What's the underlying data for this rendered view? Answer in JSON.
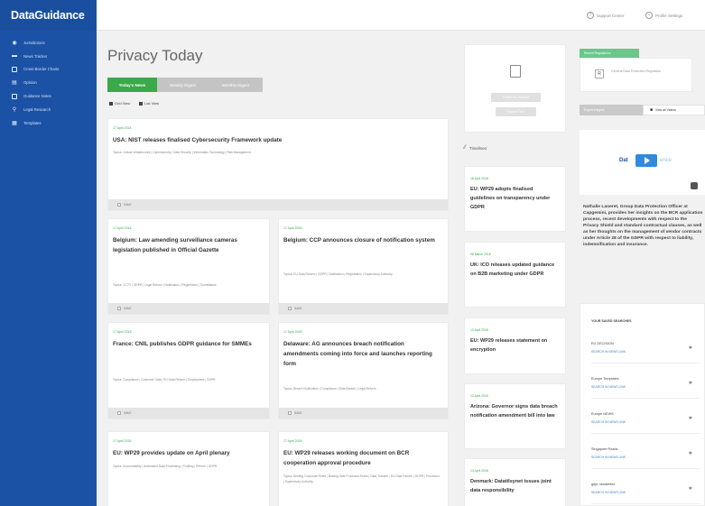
{
  "brand": "DataGuidance",
  "sidebar": {
    "items": [
      {
        "label": "Jurisdictions",
        "icon": "globe-icon"
      },
      {
        "label": "News Tracker",
        "icon": "news-icon"
      },
      {
        "label": "Cross-Border Charts",
        "icon": "chart-icon"
      },
      {
        "label": "Opinion",
        "icon": "opinion-icon"
      },
      {
        "label": "Guidance Notes",
        "icon": "notes-icon"
      },
      {
        "label": "Legal Research",
        "icon": "research-icon"
      },
      {
        "label": "Templates",
        "icon": "template-icon"
      }
    ]
  },
  "topbar": {
    "support": "Support Centre",
    "profile": "Profile Settings"
  },
  "main": {
    "title": "Privacy Today",
    "tabs": [
      "Today's News",
      "Weekly Digest",
      "Monthly Digest"
    ],
    "views": [
      "Grid View",
      "List View"
    ],
    "featured": {
      "date": "17 April 2018",
      "title": "USA: NIST releases finalised Cybersecurity Framework update",
      "topics": "Topics: Critical Infrastructure | Cybersecurity | Data Security | Information Technology | Risk Management",
      "save": "SAVE"
    },
    "cards": [
      {
        "date": "17 April 2018",
        "title": "Belgium: Law amending surveillance cameras legislation published in Official Gazette",
        "topics": "Topics: CCTV | GDPR | Legal Reform | Notification | Registration | Surveillance",
        "save": "SAVE"
      },
      {
        "date": "17 April 2018",
        "title": "Belgium: CCP announces closure of notification system",
        "topics": "Topics: EU Data Reform | GDPR | Notification | Registration | Supervisory Authority",
        "save": "SAVE"
      },
      {
        "date": "17 April 2018",
        "title": "France: CNIL publishes GDPR guidance for SMMEs",
        "topics": "Topics: Compliance | Customer Data | EU Data Reform | Employment | GDPR",
        "save": "SAVE"
      },
      {
        "date": "17 April 2018",
        "title": "Delaware: AG announces breach notification amendments coming into force and launches reporting form",
        "topics": "Topics: Breach Notification | Compliance | Data Breach | Legal Reform",
        "save": "SAVE"
      },
      {
        "date": "17 April 2018",
        "title": "EU: WP29 provides update on April plenary",
        "topics": "Topics: Accountability | Automated Data Processing | Profiling | Reform | GDPR",
        "save": ""
      },
      {
        "date": "17 April 2018",
        "title": "EU: WP29 releases working document on BCR cooperation approval procedure",
        "topics": "Topics: Binding Corporate Rules | Binding Safe Processor Rules | Data Transfer | EU Data Reform | GDPR | Processor | Supervisory Authority",
        "save": ""
      }
    ]
  },
  "timeline": {
    "btn1": "Create My Timeline",
    "btn2": "Explore Tool",
    "heading": "Timelines",
    "items": [
      {
        "date": "18 April 2018",
        "title": "EU: WP29 adopts finalised guidelines on transparency under GDPR"
      },
      {
        "date": "08 March 2018",
        "title": "UK: ICO releases updated guidance on B2B marketing under GDPR"
      },
      {
        "date": "13 April 2018",
        "title": "EU: WP29 releases statement on encryption"
      },
      {
        "date": "12 April 2018",
        "title": "Arizona: Governor signs data breach notification amendment bill into law"
      },
      {
        "date": "13 April 2018",
        "title": "Denmark: Datatilsynet issues joint data responsibility"
      }
    ]
  },
  "right": {
    "green_label": "Recent Regulations",
    "reg_text": "General Data Protection Regulation",
    "tab1": "Expert Insights",
    "tab2": "View all Videos",
    "video_brand": "Dat",
    "video_brand2": "ence",
    "desc": "Nathalie Laneret, Group Data Protection Officer at Capgemini, provides her insights on the BCR application process, recent developments with respect to the Privacy Shield and standard contractual clauses, as well as her thoughts on the management of vendor contracts under Article 28 of the GDPR with respect to liability, indemnification and insurance.",
    "saved_heading": "YOUR SAVED SEARCHES",
    "saved": [
      {
        "name": "EU DECISION",
        "link": "SEARCH IN NEWS LINK"
      },
      {
        "name": "Europe Templates",
        "link": "SEARCH IN NEWS LINK"
      },
      {
        "name": "Europe NEWS",
        "link": "SEARCH IN NEWS LINK"
      },
      {
        "name": "Singapore Roads",
        "link": "SEARCH IN NEWS LINK"
      },
      {
        "name": "gdpr newsletter",
        "link": "SEARCH IN NEWS LINK"
      }
    ]
  },
  "colors": {
    "sidebar": "#1b52a6",
    "accent_green": "#39a94a",
    "link_blue": "#4a7fc8"
  }
}
